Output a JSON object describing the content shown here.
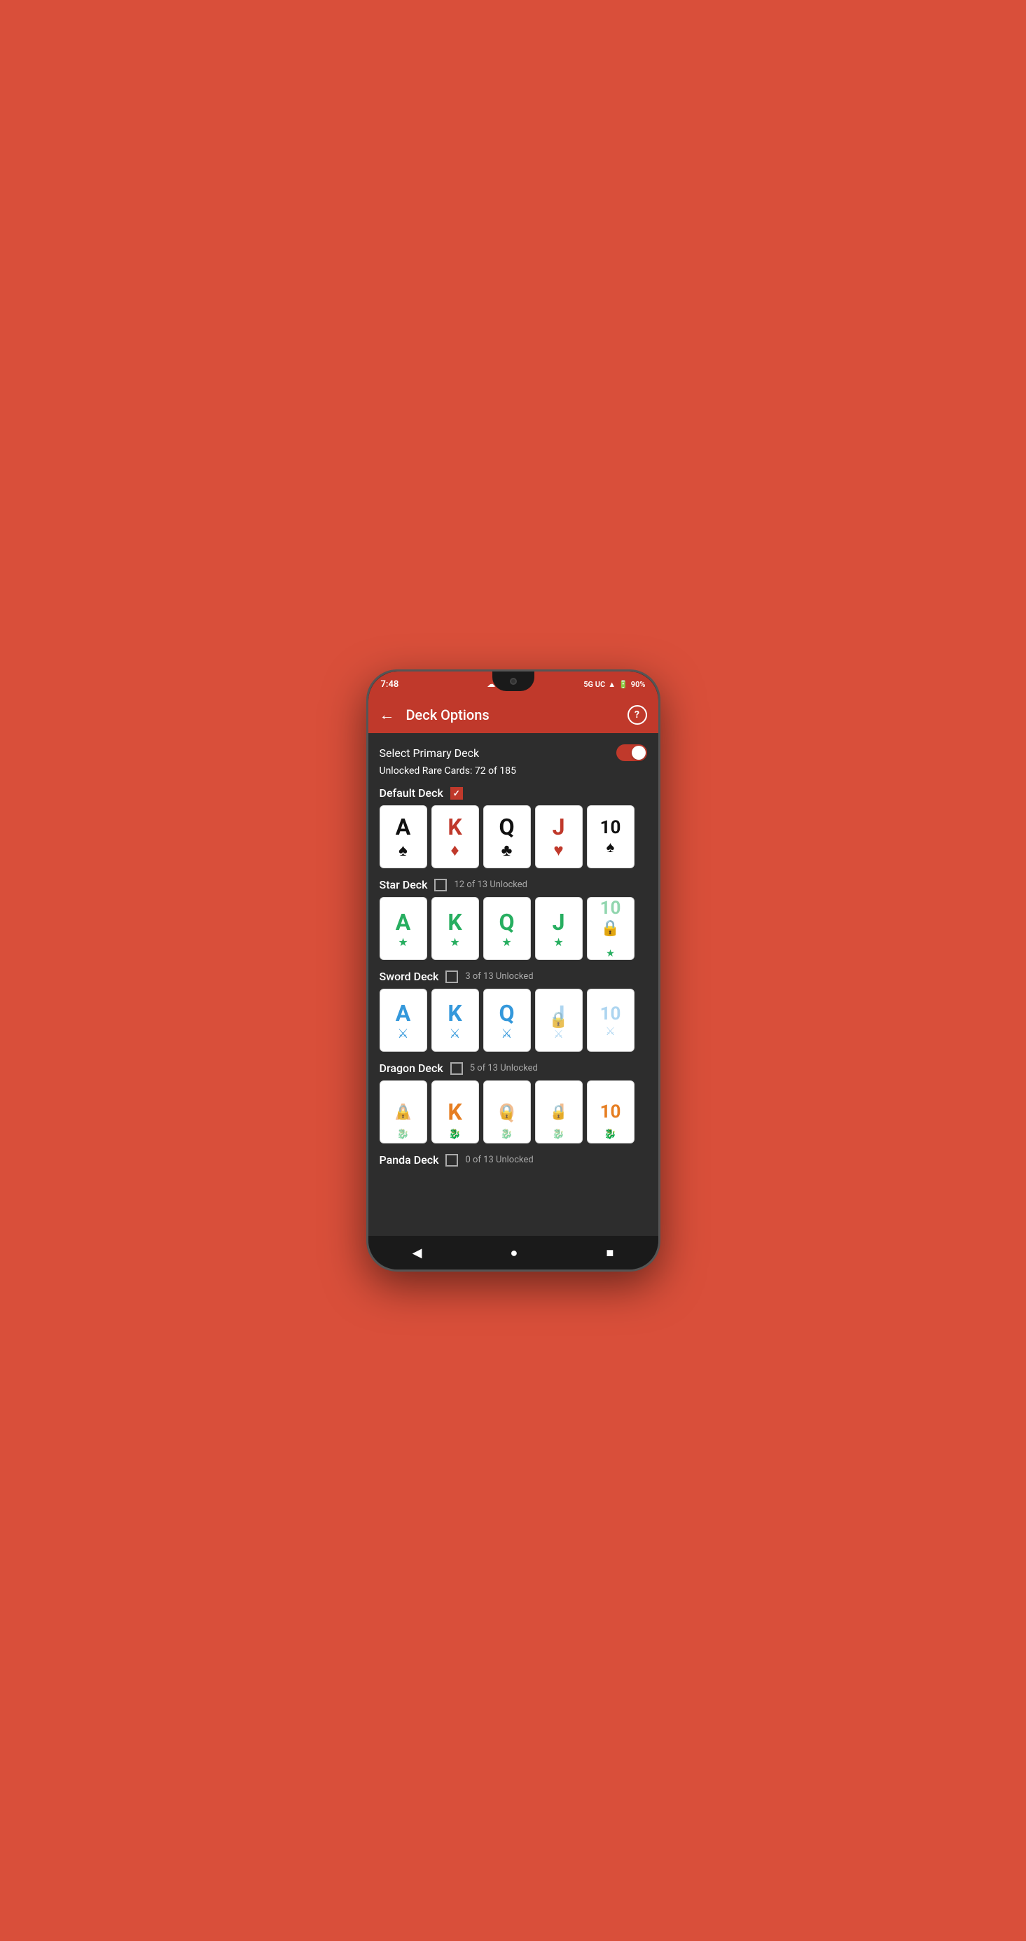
{
  "statusBar": {
    "time": "7:48",
    "network": "5G UC",
    "battery": "90%",
    "cloudIcon": "☁"
  },
  "appBar": {
    "title": "Deck Options",
    "backLabel": "←",
    "helpLabel": "?"
  },
  "options": {
    "primaryDeckLabel": "Select Primary Deck",
    "toggleState": "on",
    "unlockedRare": "Unlocked Rare Cards: 72 of 185"
  },
  "decks": [
    {
      "name": "Default Deck",
      "checked": true,
      "status": "",
      "cards": [
        {
          "letter": "A",
          "suit": "♠",
          "color": "black",
          "locked": false,
          "symbol": "♠"
        },
        {
          "letter": "K",
          "suit": "♦",
          "color": "red",
          "locked": false,
          "symbol": "♦"
        },
        {
          "letter": "Q",
          "suit": "♣",
          "color": "black",
          "locked": false,
          "symbol": "♣"
        },
        {
          "letter": "J",
          "suit": "♥",
          "color": "red",
          "locked": false,
          "symbol": "♥"
        },
        {
          "letter": "10",
          "suit": "♠",
          "color": "black",
          "locked": false,
          "symbol": "♠"
        }
      ]
    },
    {
      "name": "Star Deck",
      "checked": false,
      "status": "12 of 13 Unlocked",
      "cards": [
        {
          "letter": "A",
          "suit": "★",
          "color": "green",
          "locked": false
        },
        {
          "letter": "K",
          "suit": "★",
          "color": "green",
          "locked": false
        },
        {
          "letter": "Q",
          "suit": "★",
          "color": "green",
          "locked": false
        },
        {
          "letter": "J",
          "suit": "★",
          "color": "green",
          "locked": false
        },
        {
          "letter": "10",
          "suit": "★",
          "color": "green",
          "locked": true
        }
      ]
    },
    {
      "name": "Sword Deck",
      "checked": false,
      "status": "3 of 13 Unlocked",
      "cards": [
        {
          "letter": "A",
          "suit": "⚔",
          "color": "blue",
          "locked": false
        },
        {
          "letter": "K",
          "suit": "⚔",
          "color": "blue",
          "locked": false
        },
        {
          "letter": "Q",
          "suit": "⚔",
          "color": "blue",
          "locked": false
        },
        {
          "letter": "J",
          "suit": "⚔",
          "color": "blue",
          "locked": true
        },
        {
          "letter": "10",
          "suit": "⚔",
          "color": "blue",
          "locked": true
        }
      ]
    },
    {
      "name": "Dragon Deck",
      "checked": false,
      "status": "5 of 13 Unlocked",
      "cards": [
        {
          "letter": "A",
          "suit": "🐉",
          "color": "orange",
          "locked": true
        },
        {
          "letter": "K",
          "suit": "🐉",
          "color": "orange",
          "locked": false
        },
        {
          "letter": "Q",
          "suit": "🐉",
          "color": "orange",
          "locked": true
        },
        {
          "letter": "J",
          "suit": "🐉",
          "color": "orange",
          "locked": true
        },
        {
          "letter": "10",
          "suit": "🐉",
          "color": "orange",
          "locked": false
        }
      ]
    },
    {
      "name": "Panda Deck",
      "checked": false,
      "status": "0 of 13 Unlocked"
    }
  ],
  "bottomNav": {
    "back": "◀",
    "home": "●",
    "recents": "■"
  }
}
